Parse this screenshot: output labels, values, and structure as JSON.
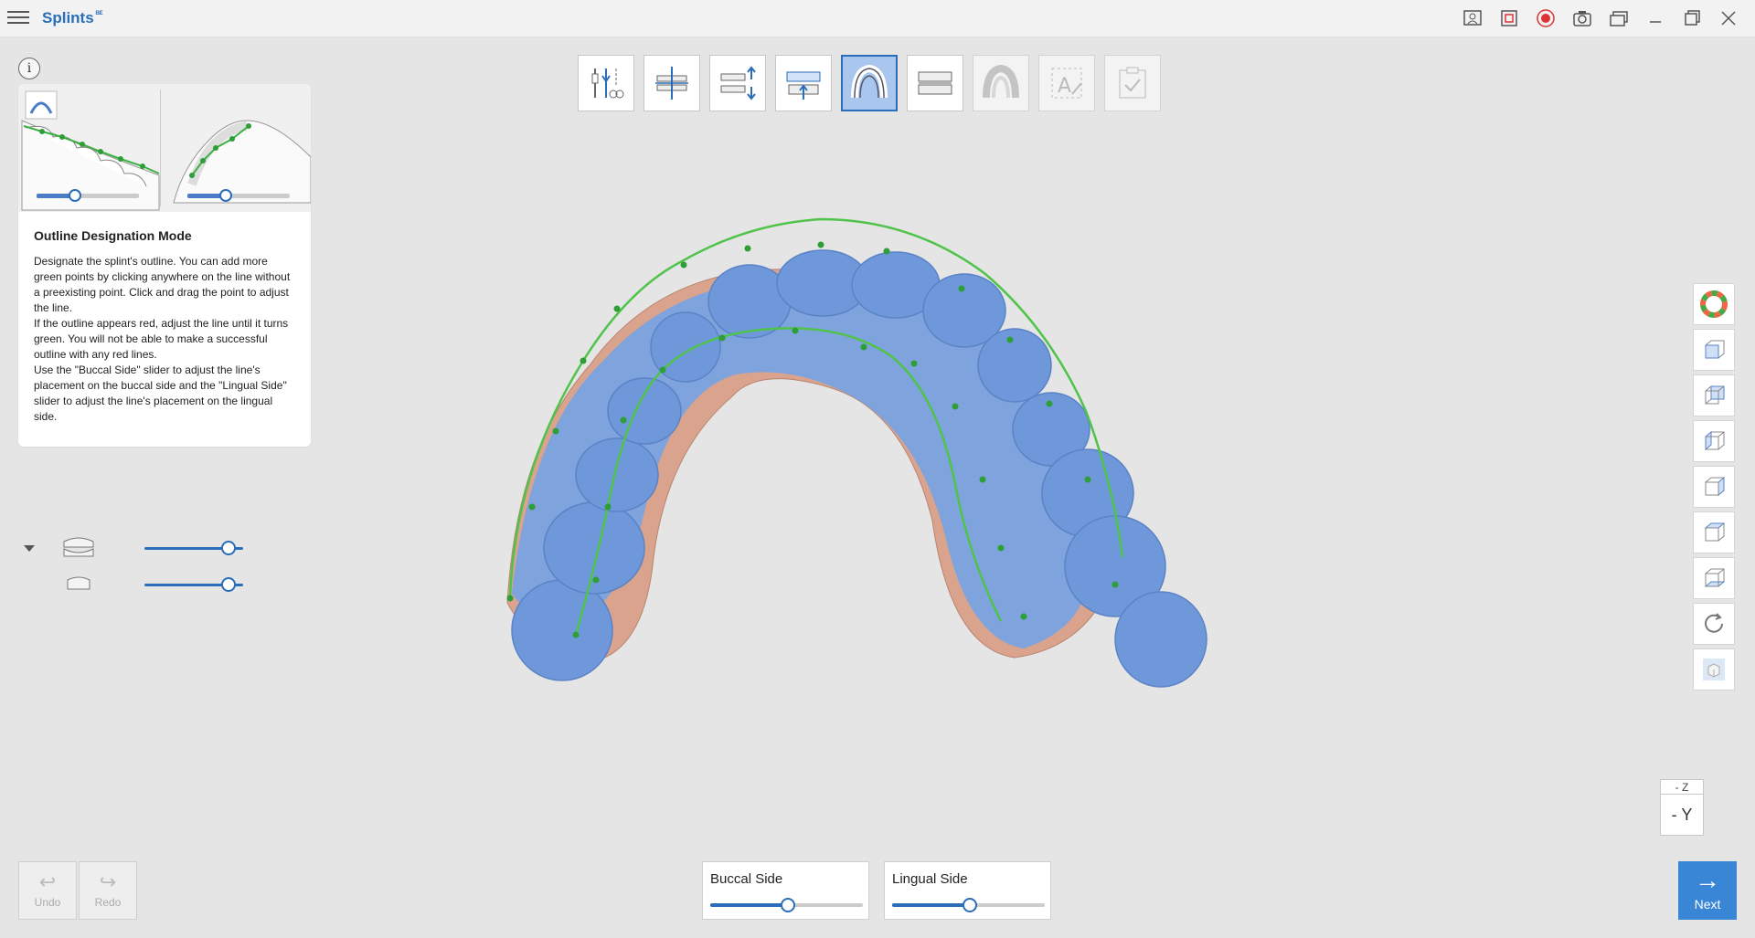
{
  "app": {
    "title": "Splints",
    "title_badge": "ᴮᴱ"
  },
  "titlebar": {
    "icons": [
      "help-manual-icon",
      "capture-area-icon",
      "record-icon",
      "camera-icon",
      "window-switch-icon",
      "minimize-icon",
      "maximize-icon",
      "close-icon"
    ]
  },
  "info": {
    "button_label": "i",
    "title": "Outline Designation Mode",
    "paragraphs": [
      "Designate the splint's outline. You can add more green points by clicking anywhere on the line without a preexisting point. Click and drag the point to adjust the line.",
      "If the outline appears red, adjust the line until it turns green. You will not be able to make a successful outline with any red lines.",
      "Use the \"Buccal Side\" slider to adjust the line's placement on the buccal side and the \"Lingual Side\" slider to adjust the line's placement on the lingual side."
    ]
  },
  "steps": [
    {
      "name": "step-trim-icon",
      "state": "normal"
    },
    {
      "name": "step-alignment-icon",
      "state": "normal"
    },
    {
      "name": "step-bite-adjust-icon",
      "state": "normal"
    },
    {
      "name": "step-insertion-icon",
      "state": "normal"
    },
    {
      "name": "step-outline-icon",
      "state": "active"
    },
    {
      "name": "step-splint-create-icon",
      "state": "normal"
    },
    {
      "name": "step-finish-icon",
      "state": "disabled"
    },
    {
      "name": "step-text-icon",
      "state": "disabled"
    },
    {
      "name": "step-check-icon",
      "state": "disabled"
    }
  ],
  "model_sliders": [
    {
      "name": "maxilla-opacity",
      "value": 1.0
    },
    {
      "name": "mandible-opacity",
      "value": 1.0
    }
  ],
  "right_tools": [
    "color-wheel-icon",
    "view-front-icon",
    "view-back-icon",
    "view-left-icon",
    "view-right-icon",
    "view-top-icon",
    "view-bottom-icon",
    "reset-view-icon",
    "view-mode-icon"
  ],
  "axis": {
    "top": "- Z",
    "main": "- Y"
  },
  "bottom": {
    "undo": "Undo",
    "redo": "Redo",
    "buccal_label": "Buccal Side",
    "buccal_value": 0.5,
    "lingual_label": "Lingual Side",
    "lingual_value": 0.5,
    "next": "Next"
  },
  "colors": {
    "accent": "#2a6db8",
    "tooth": "#6f98da",
    "gum": "#d9a38e",
    "outline": "#4fc34a"
  }
}
